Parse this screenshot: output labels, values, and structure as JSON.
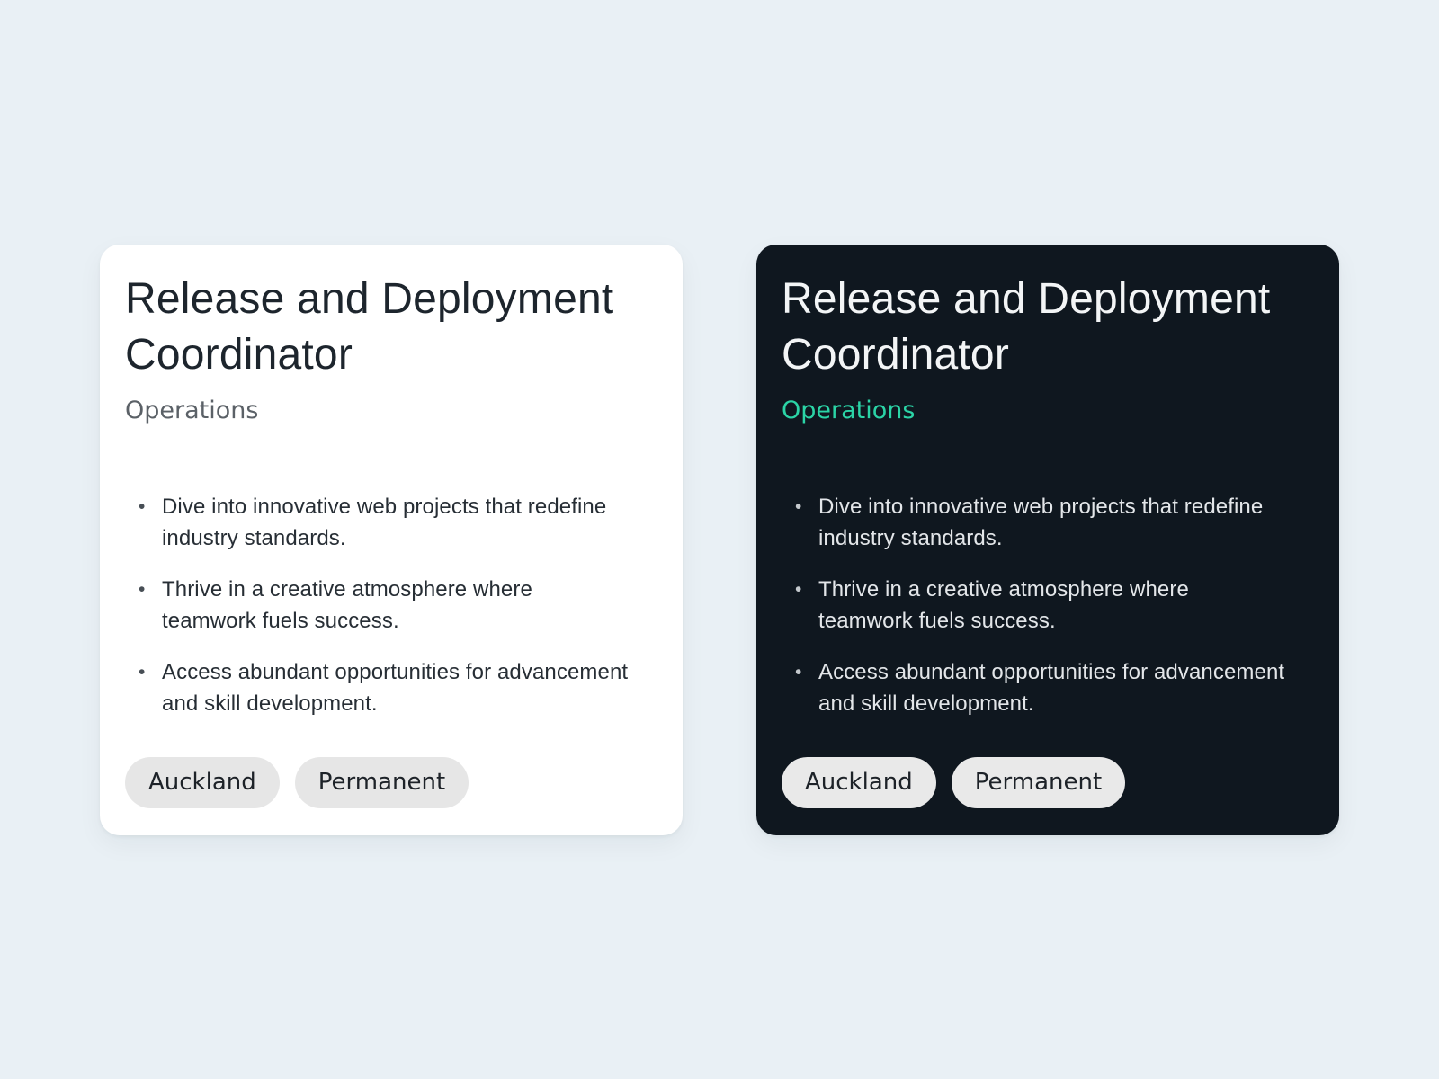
{
  "page": {
    "background_color": "#e9f0f5"
  },
  "cards": [
    {
      "theme": "light",
      "title": "Release and Deployment Coordinator",
      "department": "Operations",
      "bullet_marker": "•",
      "bullets": [
        "Dive into innovative web projects that redefine industry standards.",
        "Thrive in a creative atmosphere where teamwork fuels success.",
        "Access abundant opportunities for advancement and skill development."
      ],
      "tags": [
        "Auckland",
        "Permanent"
      ],
      "colors": {
        "card_background": "#ffffff",
        "title_text": "#1d252d",
        "department_text": "#5b6167",
        "body_text": "#272e35",
        "tag_background": "#e6e6e6",
        "tag_text": "#1d2228"
      }
    },
    {
      "theme": "dark",
      "title": "Release and Deployment Coordinator",
      "department": "Operations",
      "bullet_marker": "•",
      "bullets": [
        "Dive into innovative web projects that redefine industry standards.",
        "Thrive in a creative atmosphere where teamwork fuels success.",
        "Access abundant opportunities for advancement and skill development."
      ],
      "tags": [
        "Auckland",
        "Permanent"
      ],
      "colors": {
        "card_background": "#0f171f",
        "title_text": "#f3f5f6",
        "department_text": "#2bd4a6",
        "body_text": "#e3e6e9",
        "tag_background": "#e9e9e9",
        "tag_text": "#1d2228"
      }
    }
  ]
}
